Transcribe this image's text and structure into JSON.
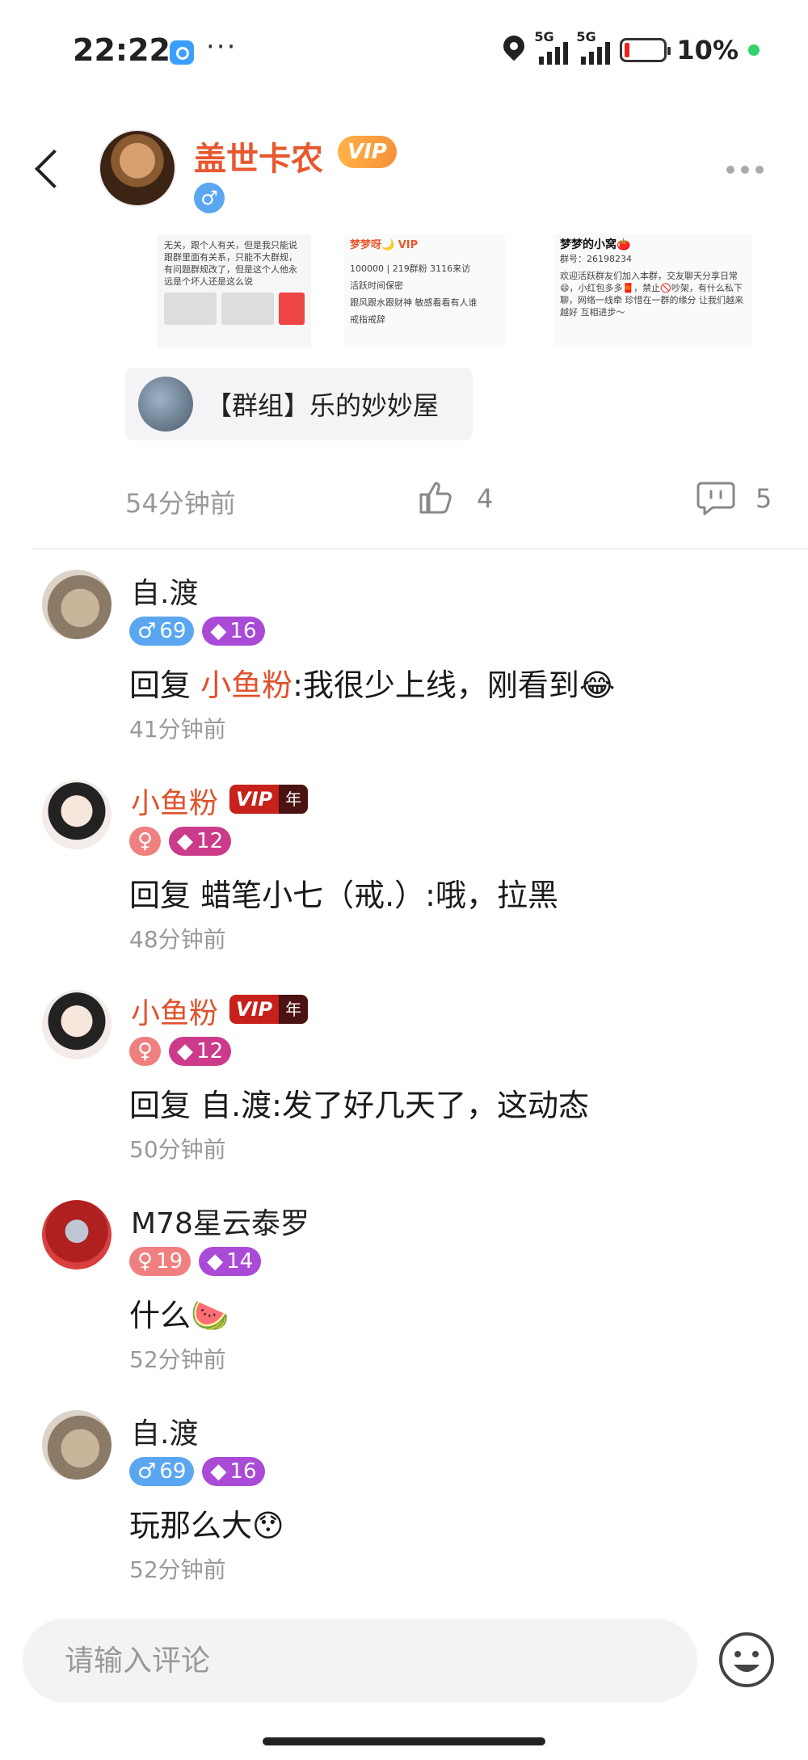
{
  "status_bar": {
    "time": "22:22",
    "dots": "···",
    "network_1": "5G",
    "network_2": "5G",
    "battery": "10%"
  },
  "post": {
    "author": "盖世卡农",
    "vip": "VIP",
    "gender_symbol": "♂",
    "images": {
      "img1_text": "无关，跟个人有关，但是我只能说跟群里面有关系，只能不大群规，有问题群规改了，但是这个人他永远是个坏人还是这么说",
      "img2_title": "梦梦呀🌙 VIP",
      "img2_lines": [
        "100000 | 219群粉 3116来访",
        "活跃时间保密",
        "跟风跟水跟财神  敏感看看有人谁",
        "戒指戒辞"
      ],
      "img3_title": "梦梦的小窝🍅",
      "img3_id": "群号：26198234",
      "img3_text": "欢迎活跃群友们加入本群，交友聊天分享日常😄，小红包多多🧧，禁止🚫吵架，有什么私下聊，网络一线牵 珍惜在一群的缘分 让我们越来越好 互相进步～"
    },
    "group_chip": "【群组】乐的妙妙屋",
    "time": "54分钟前",
    "likes": "4",
    "comments": "5"
  },
  "comments": [
    {
      "name": "自.渡",
      "gender": "♂",
      "age": "69",
      "level": "16",
      "text_prefix": "回复 ",
      "mention": "小鱼粉",
      "text": ":我很少上线，刚看到😂",
      "time": "41分钟前"
    },
    {
      "name": "小鱼粉",
      "vip": "VIP",
      "vip_year": "年",
      "gender": "♀",
      "level": "12",
      "text_prefix": "回复 ",
      "text": "蜡笔小七（戒.）:哦，拉黑",
      "time": "48分钟前"
    },
    {
      "name": "小鱼粉",
      "vip": "VIP",
      "vip_year": "年",
      "gender": "♀",
      "level": "12",
      "text_prefix": "回复 ",
      "text": "自.渡:发了好几天了，这动态",
      "time": "50分钟前"
    },
    {
      "name": "M78星云泰罗",
      "gender": "♀",
      "age": "19",
      "level": "14",
      "text": "什么🍉",
      "time": "52分钟前"
    },
    {
      "name": "自.渡",
      "gender": "♂",
      "age": "69",
      "level": "16",
      "text": "玩那么大😯",
      "time": "52分钟前"
    }
  ],
  "input": {
    "placeholder": "请输入评论"
  },
  "icons": {
    "back": "back-arrow-icon",
    "more": "more-dots-icon",
    "like": "thumbs-up-icon",
    "comment": "comment-bubble-icon",
    "emoji": "emoji-smile-icon"
  },
  "colors": {
    "accent": "#e0522c",
    "vip_gold": "#f7913a",
    "male": "#5aa6f0",
    "female": "#f08080",
    "level": "#a94bd6"
  }
}
